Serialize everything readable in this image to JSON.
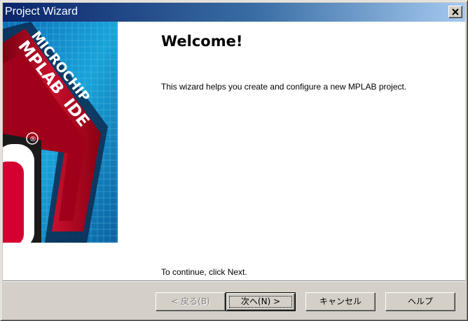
{
  "window": {
    "title": "Project Wizard"
  },
  "banner": {
    "brand_line1": "MICROCHIP",
    "brand_line2": "MPLAB",
    "brand_line3": "IDE",
    "registered": "®"
  },
  "main": {
    "heading": "Welcome!",
    "description": "This wizard helps you create and configure a new MPLAB project.",
    "continue_hint": "To continue, click Next."
  },
  "buttons": {
    "back_label": "< 戻る(B)",
    "next_label": "次へ(N) >",
    "cancel_label": "キャンセル",
    "help_label": "ヘルプ"
  },
  "colors": {
    "title_start": "#0a246a",
    "title_end": "#a6caf0",
    "banner_blue": "#1aa3d9",
    "banner_red": "#b3001e"
  }
}
